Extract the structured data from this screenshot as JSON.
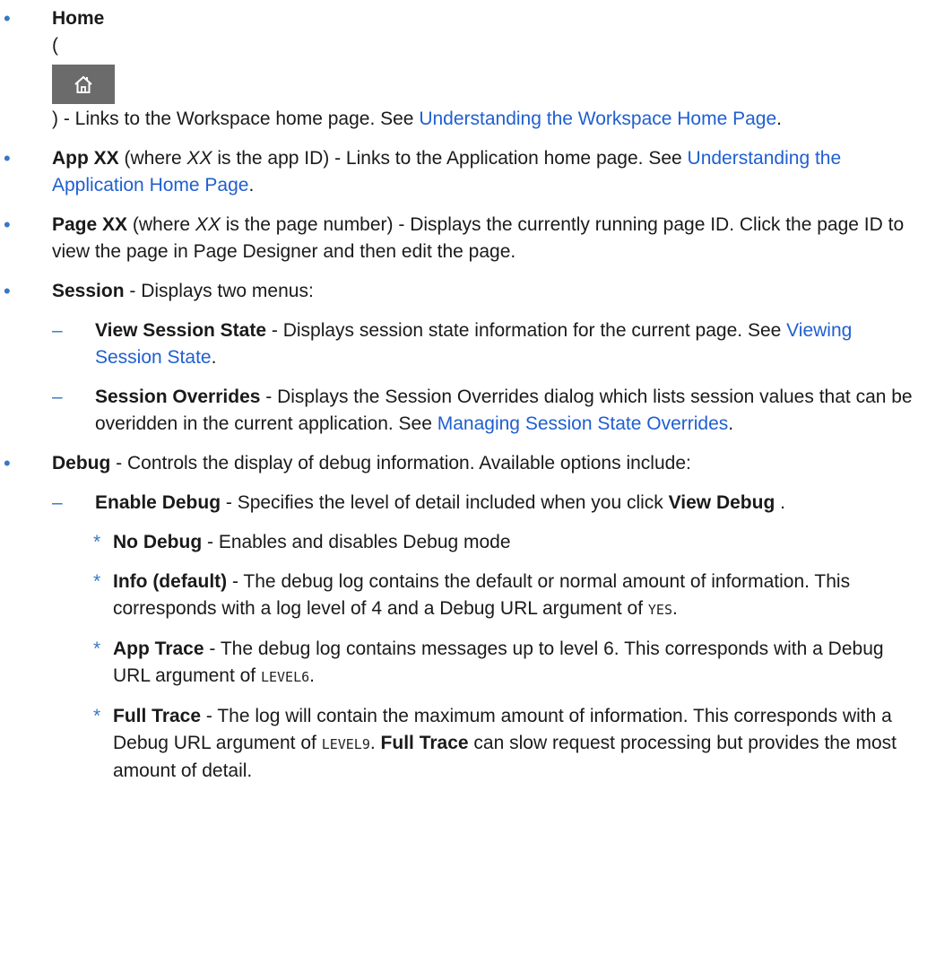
{
  "bullets": {
    "l1": "•",
    "l2": "–",
    "l3": "*"
  },
  "home": {
    "title": "Home",
    "open_paren": "(",
    "icon": "home-icon",
    "text": ") - Links to the Workspace home page. See ",
    "link": "Understanding the Workspace Home Page",
    "end": "."
  },
  "app": {
    "title": "App XX",
    "paren_pre": " (where ",
    "var": "XX",
    "paren_post": " is the app ID) - Links to the Application home page. See ",
    "link": "Understanding the Application Home Page",
    "end": "."
  },
  "page": {
    "title": "Page XX",
    "paren_pre": " (where ",
    "var": "XX",
    "paren_post": " is the page number) - Displays the currently running page ID. Click the page ID to view the page in Page Designer and then edit the page."
  },
  "session": {
    "title": "Session",
    "text": " - Displays two menus:",
    "sub": {
      "view_state": {
        "title": "View Session State",
        "text": " - Displays session state information for the current page. See ",
        "link": "Viewing Session State",
        "end": "."
      },
      "overrides": {
        "title": "Session Overrides",
        "text": " - Displays the Session Overrides dialog which lists session values that can be overidden in the current application. See ",
        "link": "Managing Session State Overrides",
        "end": "."
      }
    }
  },
  "debug": {
    "title": "Debug",
    "text": " - Controls the display of debug information. Available options include:",
    "enable": {
      "title": "Enable Debug",
      "text": " - Specifies the level of detail included when you click ",
      "bold_ref": "View Debug",
      "end": " ."
    },
    "levels": {
      "no_debug": {
        "title": "No Debug",
        "text": " - Enables and disables Debug mode"
      },
      "info": {
        "title": "Info (default)",
        "text": " - The debug log contains the default or normal amount of information. This corresponds with a log level of 4 and a Debug URL argument of ",
        "code": "YES",
        "end": "."
      },
      "app_trace": {
        "title": "App Trace",
        "text": " - The debug log contains messages up to level 6. This corresponds with a Debug URL argument of ",
        "code": "LEVEL6",
        "end": "."
      },
      "full_trace": {
        "title": "Full Trace",
        "text": " - The log will contain the maximum amount of information. This corresponds with a Debug URL argument of ",
        "code": "LEVEL9",
        "mid": ". ",
        "bold_ref": "Full Trace",
        "text2": " can slow request processing but provides the most amount of detail."
      }
    }
  }
}
